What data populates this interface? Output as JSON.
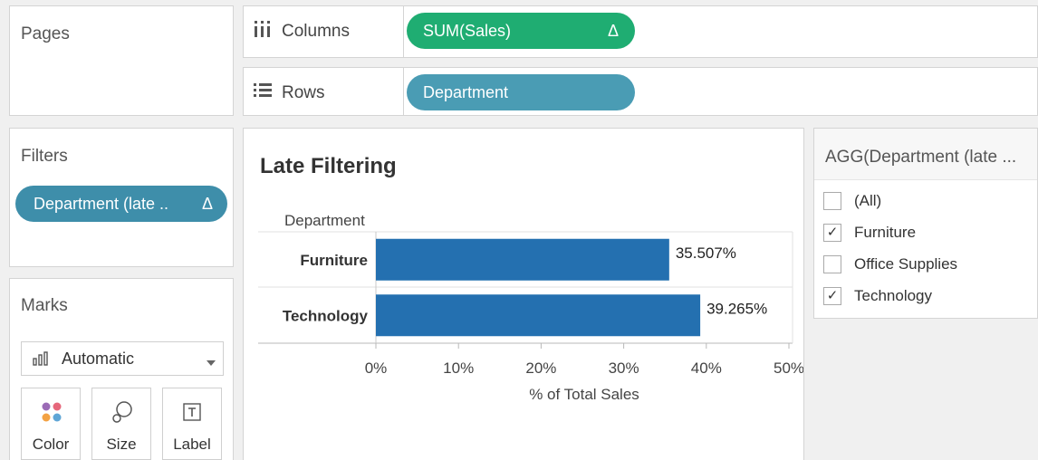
{
  "pages": {
    "title": "Pages"
  },
  "columns": {
    "icon": "columns-icon",
    "label": "Columns",
    "pill": "SUM(Sales)",
    "pill_flag": "Δ",
    "pill_color": "#1fad72"
  },
  "rows": {
    "icon": "rows-icon",
    "label": "Rows",
    "pill": "Department",
    "pill_color": "#4a9cb4"
  },
  "filters": {
    "title": "Filters",
    "pill": "Department (late ..",
    "pill_flag": "Δ",
    "pill_color": "#3e8eaa"
  },
  "marks": {
    "title": "Marks",
    "type_label": "Automatic",
    "cards": [
      {
        "icon": "color-icon",
        "label": "Color"
      },
      {
        "icon": "size-icon",
        "label": "Size"
      },
      {
        "icon": "label-icon",
        "label": "Label"
      }
    ]
  },
  "legend": {
    "title": "AGG(Department (late ...",
    "items": [
      {
        "label": "(All)",
        "checked": false
      },
      {
        "label": "Furniture",
        "checked": true
      },
      {
        "label": "Office Supplies",
        "checked": false
      },
      {
        "label": "Technology",
        "checked": true
      }
    ],
    "check_mark": "✓"
  },
  "chart_data": {
    "type": "bar",
    "orientation": "horizontal",
    "title": "Late Filtering",
    "row_header": "Department",
    "categories": [
      "Furniture",
      "Technology"
    ],
    "values": [
      35.507,
      39.265
    ],
    "value_labels": [
      "35.507%",
      "39.265%"
    ],
    "xlabel": "% of Total Sales",
    "xlim": [
      0,
      50
    ],
    "ticks": [
      0,
      10,
      20,
      30,
      40,
      50
    ],
    "tick_labels": [
      "0%",
      "10%",
      "20%",
      "30%",
      "40%",
      "50%"
    ],
    "bar_color": "#2470b0",
    "grid": false
  }
}
